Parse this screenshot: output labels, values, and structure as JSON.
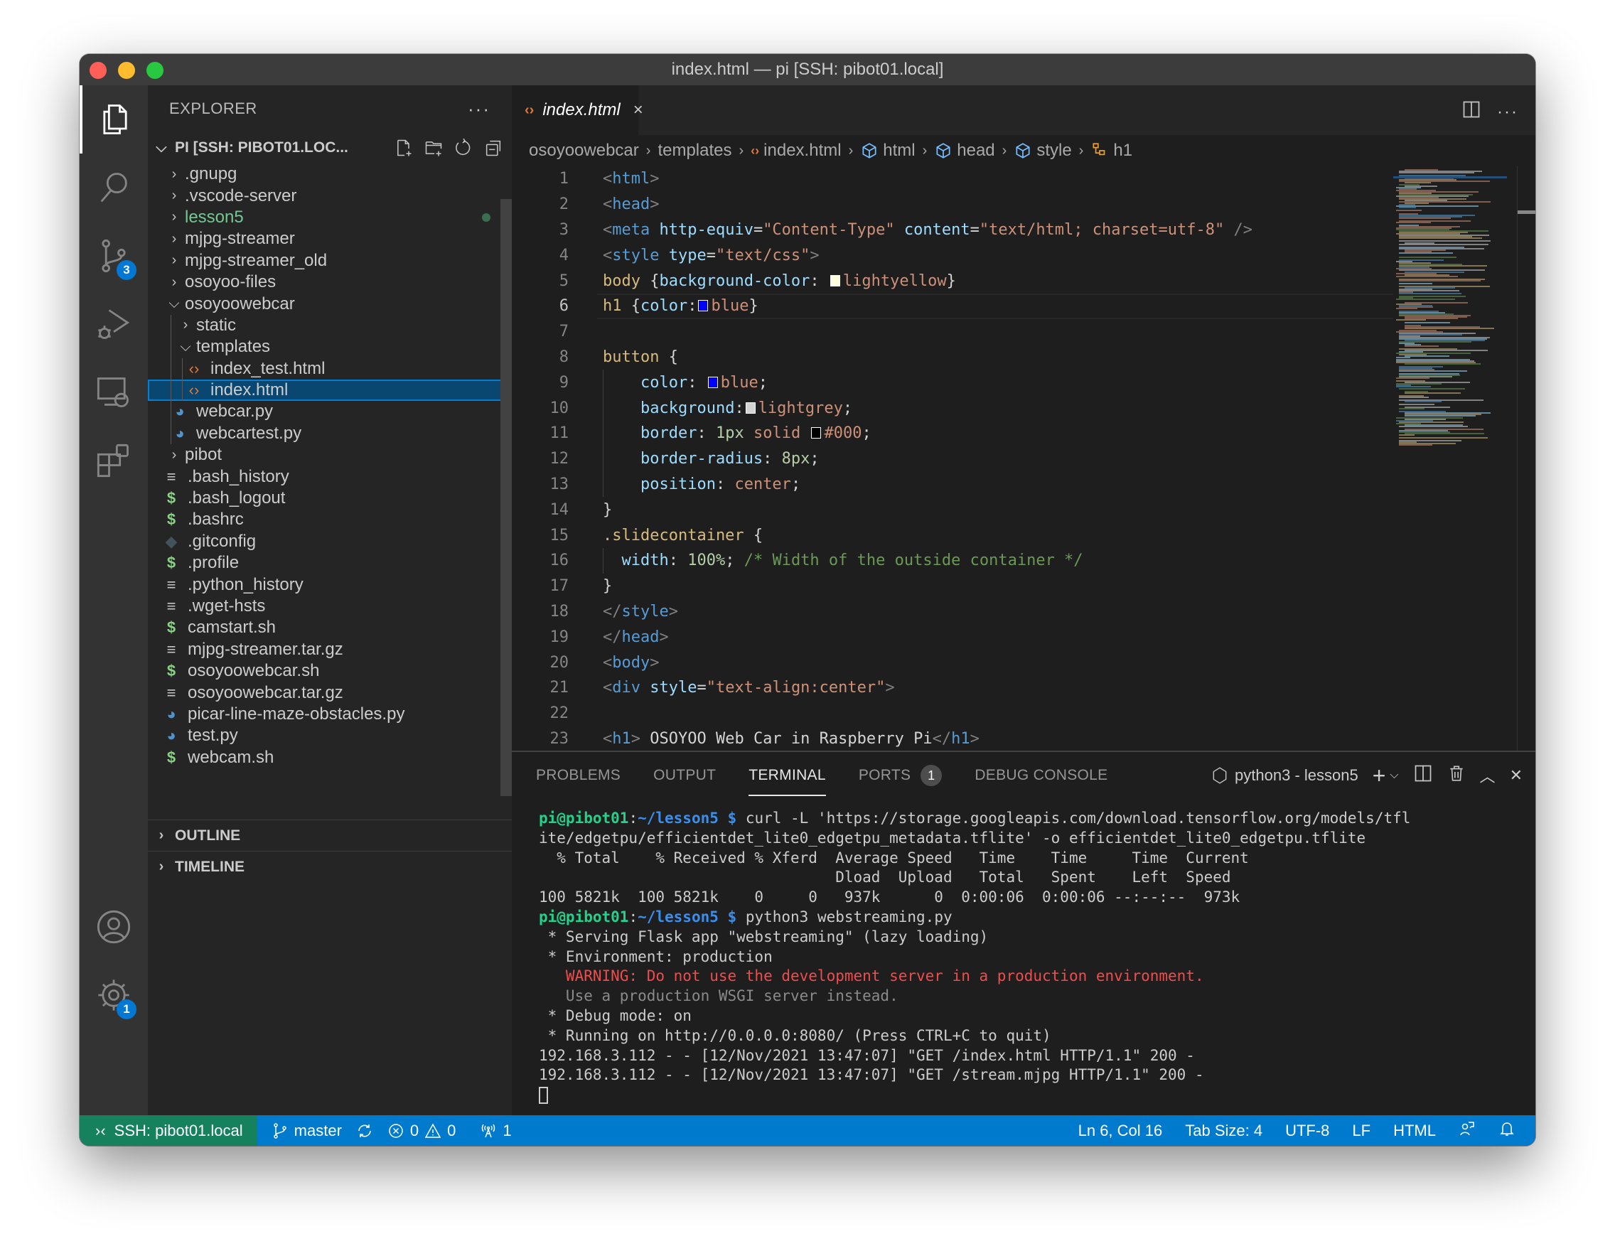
{
  "window": {
    "title": "index.html — pi [SSH: pibot01.local]"
  },
  "activity_bar": {
    "items": [
      {
        "name": "explorer",
        "active": true
      },
      {
        "name": "search"
      },
      {
        "name": "source-control",
        "badge": "3"
      },
      {
        "name": "run-and-debug"
      },
      {
        "name": "remote-explorer"
      },
      {
        "name": "extensions"
      }
    ],
    "bottom": [
      {
        "name": "accounts"
      },
      {
        "name": "manage",
        "badge": "1"
      }
    ]
  },
  "sidebar": {
    "title": "EXPLORER",
    "more": "···",
    "root_label": "PI [SSH: PIBOT01.LOC...",
    "tree": [
      {
        "label": ".gnupg",
        "type": "folder",
        "depth": 0,
        "expanded": false
      },
      {
        "label": ".vscode-server",
        "type": "folder",
        "depth": 0,
        "expanded": false
      },
      {
        "label": "lesson5",
        "type": "folder",
        "depth": 0,
        "expanded": false,
        "git_modified": true
      },
      {
        "label": "mjpg-streamer",
        "type": "folder",
        "depth": 0,
        "expanded": false
      },
      {
        "label": "mjpg-streamer_old",
        "type": "folder",
        "depth": 0,
        "expanded": false
      },
      {
        "label": "osoyoo-files",
        "type": "folder",
        "depth": 0,
        "expanded": false
      },
      {
        "label": "osoyoowebcar",
        "type": "folder",
        "depth": 0,
        "expanded": true
      },
      {
        "label": "static",
        "type": "folder",
        "depth": 1,
        "expanded": false
      },
      {
        "label": "templates",
        "type": "folder",
        "depth": 1,
        "expanded": true
      },
      {
        "label": "index_test.html",
        "type": "html",
        "depth": 2
      },
      {
        "label": "index.html",
        "type": "html",
        "depth": 2,
        "selected": true
      },
      {
        "label": "webcar.py",
        "type": "python",
        "depth": 1
      },
      {
        "label": "webcartest.py",
        "type": "python",
        "depth": 1
      },
      {
        "label": "pibot",
        "type": "folder",
        "depth": 0,
        "expanded": false
      },
      {
        "label": ".bash_history",
        "type": "text",
        "depth": 0
      },
      {
        "label": ".bash_logout",
        "type": "shell",
        "depth": 0
      },
      {
        "label": ".bashrc",
        "type": "shell",
        "depth": 0
      },
      {
        "label": ".gitconfig",
        "type": "git",
        "depth": 0
      },
      {
        "label": ".profile",
        "type": "shell",
        "depth": 0
      },
      {
        "label": ".python_history",
        "type": "text",
        "depth": 0
      },
      {
        "label": ".wget-hsts",
        "type": "text",
        "depth": 0
      },
      {
        "label": "camstart.sh",
        "type": "shell",
        "depth": 0
      },
      {
        "label": "mjpg-streamer.tar.gz",
        "type": "text",
        "depth": 0
      },
      {
        "label": "osoyoowebcar.sh",
        "type": "shell",
        "depth": 0
      },
      {
        "label": "osoyoowebcar.tar.gz",
        "type": "text",
        "depth": 0
      },
      {
        "label": "picar-line-maze-obstacles.py",
        "type": "python",
        "depth": 0
      },
      {
        "label": "test.py",
        "type": "python",
        "depth": 0
      },
      {
        "label": "webcam.sh",
        "type": "shell",
        "depth": 0
      }
    ],
    "sections": [
      "OUTLINE",
      "TIMELINE"
    ]
  },
  "editor": {
    "tab": {
      "label": "index.html",
      "close": "×"
    },
    "breadcrumb": [
      {
        "label": "osoyoowebcar",
        "icon": null
      },
      {
        "label": "templates",
        "icon": null
      },
      {
        "label": "index.html",
        "icon": "html"
      },
      {
        "label": "html",
        "icon": "element"
      },
      {
        "label": "head",
        "icon": "element"
      },
      {
        "label": "style",
        "icon": "element"
      },
      {
        "label": "h1",
        "icon": "selector"
      }
    ],
    "current_line": 6,
    "lines": [
      [
        [
          "t-punc",
          "<"
        ],
        [
          "t-tag",
          "html"
        ],
        [
          "t-punc",
          ">"
        ]
      ],
      [
        [
          "t-punc",
          "<"
        ],
        [
          "t-tag",
          "head"
        ],
        [
          "t-punc",
          ">"
        ]
      ],
      [
        [
          "t-punc",
          "<"
        ],
        [
          "t-tag",
          "meta"
        ],
        [
          "t-text",
          " "
        ],
        [
          "t-attr",
          "http-equiv"
        ],
        [
          "t-text",
          "="
        ],
        [
          "t-str",
          "\"Content-Type\""
        ],
        [
          "t-text",
          " "
        ],
        [
          "t-attr",
          "content"
        ],
        [
          "t-text",
          "="
        ],
        [
          "t-str",
          "\"text/html; charset=utf-8\""
        ],
        [
          "t-text",
          " "
        ],
        [
          "t-punc",
          "/>"
        ]
      ],
      [
        [
          "t-punc",
          "<"
        ],
        [
          "t-tag",
          "style"
        ],
        [
          "t-text",
          " "
        ],
        [
          "t-attr",
          "type"
        ],
        [
          "t-text",
          "="
        ],
        [
          "t-str",
          "\"text/css\""
        ],
        [
          "t-punc",
          ">"
        ]
      ],
      [
        [
          "t-sel",
          "body"
        ],
        [
          "t-brace",
          " {"
        ],
        [
          "t-prop",
          "background-color"
        ],
        [
          "t-text",
          ": "
        ],
        [
          "swatch",
          "#ffffe0"
        ],
        [
          "t-val",
          "lightyellow"
        ],
        [
          "t-brace",
          "}"
        ]
      ],
      [
        [
          "t-sel",
          "h1"
        ],
        [
          "t-brace",
          " {"
        ],
        [
          "t-prop",
          "color"
        ],
        [
          "t-text",
          ":"
        ],
        [
          "swatch",
          "#0000ff"
        ],
        [
          "t-val",
          "blue"
        ],
        [
          "t-brace",
          "}"
        ]
      ],
      [],
      [
        [
          "t-sel",
          "button"
        ],
        [
          "t-brace",
          " {"
        ]
      ],
      [
        [
          "t-text",
          "    "
        ],
        [
          "t-prop",
          "color"
        ],
        [
          "t-text",
          ": "
        ],
        [
          "swatch",
          "#0000ff"
        ],
        [
          "t-val",
          "blue"
        ],
        [
          "t-text",
          ";"
        ]
      ],
      [
        [
          "t-text",
          "    "
        ],
        [
          "t-prop",
          "background"
        ],
        [
          "t-text",
          ":"
        ],
        [
          "swatch",
          "#d3d3d3"
        ],
        [
          "t-val",
          "lightgrey"
        ],
        [
          "t-text",
          ";"
        ]
      ],
      [
        [
          "t-text",
          "    "
        ],
        [
          "t-prop",
          "border"
        ],
        [
          "t-text",
          ": "
        ],
        [
          "t-num",
          "1px"
        ],
        [
          "t-text",
          " "
        ],
        [
          "t-val",
          "solid"
        ],
        [
          "t-text",
          " "
        ],
        [
          "swatch",
          "#000000"
        ],
        [
          "t-val",
          "#000"
        ],
        [
          "t-text",
          ";"
        ]
      ],
      [
        [
          "t-text",
          "    "
        ],
        [
          "t-prop",
          "border-radius"
        ],
        [
          "t-text",
          ": "
        ],
        [
          "t-num",
          "8px"
        ],
        [
          "t-text",
          ";"
        ]
      ],
      [
        [
          "t-text",
          "    "
        ],
        [
          "t-prop",
          "position"
        ],
        [
          "t-text",
          ": "
        ],
        [
          "t-val",
          "center"
        ],
        [
          "t-text",
          ";"
        ]
      ],
      [
        [
          "t-brace",
          "}"
        ]
      ],
      [
        [
          "t-sel",
          ".slidecontainer"
        ],
        [
          "t-brace",
          " {"
        ]
      ],
      [
        [
          "t-text",
          "  "
        ],
        [
          "t-prop",
          "width"
        ],
        [
          "t-text",
          ": "
        ],
        [
          "t-num",
          "100%"
        ],
        [
          "t-text",
          "; "
        ],
        [
          "t-com",
          "/* Width of the outside container */"
        ]
      ],
      [
        [
          "t-brace",
          "}"
        ]
      ],
      [
        [
          "t-punc",
          "</"
        ],
        [
          "t-tag",
          "style"
        ],
        [
          "t-punc",
          ">"
        ]
      ],
      [
        [
          "t-punc",
          "</"
        ],
        [
          "t-tag",
          "head"
        ],
        [
          "t-punc",
          ">"
        ]
      ],
      [
        [
          "t-punc",
          "<"
        ],
        [
          "t-tag",
          "body"
        ],
        [
          "t-punc",
          ">"
        ]
      ],
      [
        [
          "t-punc",
          "<"
        ],
        [
          "t-tag",
          "div"
        ],
        [
          "t-text",
          " "
        ],
        [
          "t-attr",
          "style"
        ],
        [
          "t-text",
          "="
        ],
        [
          "t-str",
          "\"text-align:center\""
        ],
        [
          "t-punc",
          ">"
        ]
      ],
      [],
      [
        [
          "t-punc",
          "<"
        ],
        [
          "t-tag",
          "h1"
        ],
        [
          "t-punc",
          ">"
        ],
        [
          "t-text",
          " OSOYOO Web Car in Raspberry Pi"
        ],
        [
          "t-punc",
          "</"
        ],
        [
          "t-tag",
          "h1"
        ],
        [
          "t-punc",
          ">"
        ]
      ]
    ]
  },
  "panel": {
    "tabs": [
      {
        "label": "PROBLEMS"
      },
      {
        "label": "OUTPUT"
      },
      {
        "label": "TERMINAL",
        "active": true
      },
      {
        "label": "PORTS",
        "count": "1"
      },
      {
        "label": "DEBUG CONSOLE"
      }
    ],
    "terminal_name": "python3 - lesson5",
    "terminal_lines": [
      [
        [
          "p-user",
          "pi@pibot01"
        ],
        [
          "",
          ":"
        ],
        [
          "p-path",
          "~/lesson5 $"
        ],
        [
          "",
          " curl -L 'https://storage.googleapis.com/download.tensorflow.org/models/tfl"
        ]
      ],
      [
        [
          "",
          "ite/edgetpu/efficientdet_lite0_edgetpu_metadata.tflite' -o efficientdet_lite0_edgetpu.tflite"
        ]
      ],
      [
        [
          "",
          "  % Total    % Received % Xferd  Average Speed   Time    Time     Time  Current"
        ]
      ],
      [
        [
          "",
          "                                 Dload  Upload   Total   Spent    Left  Speed"
        ]
      ],
      [
        [
          "",
          "100 5821k  100 5821k    0     0   937k      0  0:00:06  0:00:06 --:--:--  973k"
        ]
      ],
      [
        [
          "p-user",
          "pi@pibot01"
        ],
        [
          "",
          ":"
        ],
        [
          "p-path",
          "~/lesson5 $"
        ],
        [
          "",
          " python3 webstreaming.py"
        ]
      ],
      [
        [
          "",
          " * Serving Flask app \"webstreaming\" (lazy loading)"
        ]
      ],
      [
        [
          "",
          " * Environment: production"
        ]
      ],
      [
        [
          "warn",
          "   WARNING: Do not use the development server in a production environment."
        ]
      ],
      [
        [
          "dim",
          "   Use a production WSGI server instead."
        ]
      ],
      [
        [
          "",
          " * Debug mode: on"
        ]
      ],
      [
        [
          "",
          " * Running on http://0.0.0.0:8080/ (Press CTRL+C to quit)"
        ]
      ],
      [
        [
          "",
          "192.168.3.112 - - [12/Nov/2021 13:47:07] \"GET /index.html HTTP/1.1\" 200 -"
        ]
      ],
      [
        [
          "",
          "192.168.3.112 - - [12/Nov/2021 13:47:07] \"GET /stream.mjpg HTTP/1.1\" 200 -"
        ]
      ]
    ]
  },
  "statusbar": {
    "remote": "SSH: pibot01.local",
    "branch": "master",
    "errors": "0",
    "warnings": "0",
    "ports": "1",
    "cursor_position": "Ln 6, Col 16",
    "tab_size": "Tab Size: 4",
    "encoding": "UTF-8",
    "eol": "LF",
    "language": "HTML"
  },
  "colors": {
    "statusbar": "#007acc",
    "remote": "#16825d",
    "selection": "#094771",
    "badge": "#0078d4"
  }
}
